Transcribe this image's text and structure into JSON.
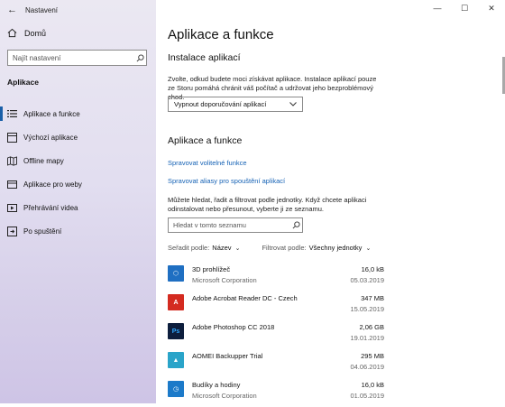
{
  "window": {
    "title": "Nastavení",
    "controls": [
      "—",
      "☐",
      "✕"
    ]
  },
  "sidebar": {
    "home_label": "Domů",
    "search_placeholder": "Najít nastavení",
    "section_label": "Aplikace",
    "items": [
      {
        "label": "Aplikace a funkce",
        "icon": "list-icon",
        "active": true
      },
      {
        "label": "Výchozí aplikace",
        "icon": "default-apps-icon",
        "active": false
      },
      {
        "label": "Offline mapy",
        "icon": "map-icon",
        "active": false
      },
      {
        "label": "Aplikace pro weby",
        "icon": "web-apps-icon",
        "active": false
      },
      {
        "label": "Přehrávání videa",
        "icon": "video-icon",
        "active": false
      },
      {
        "label": "Po spuštění",
        "icon": "startup-icon",
        "active": false
      }
    ]
  },
  "main": {
    "title": "Aplikace a funkce",
    "install_heading": "Instalace aplikací",
    "install_desc": "Zvolte, odkud budete moci získávat aplikace. Instalace aplikací pouze ze Storu pomáhá chránit váš počítač a udržovat jeho bezproblémový chod.",
    "install_dropdown": "Vypnout doporučování aplikací",
    "apps_heading": "Aplikace a funkce",
    "link_optional": "Spravovat volitelné funkce",
    "link_aliases": "Spravovat aliasy pro spouštění aplikací",
    "apps_desc": "Můžete hledat, řadit a filtrovat podle jednotky. Když chcete aplikaci odinstalovat nebo přesunout, vyberte ji ze seznamu.",
    "apps_search_placeholder": "Hledat v tomto seznamu",
    "sort_label": "Seřadit podle:",
    "sort_value": "Název",
    "filter_label": "Filtrovat podle:",
    "filter_value": "Všechny jednotky"
  },
  "apps": [
    {
      "name": "3D prohlížeč",
      "publisher": "Microsoft Corporation",
      "size": "16,0 kB",
      "date": "05.03.2019",
      "icon_bg": "#1f6fc2",
      "icon_glyph": "⬡"
    },
    {
      "name": "Adobe Acrobat Reader DC - Czech",
      "publisher": "",
      "size": "347 MB",
      "date": "15.05.2019",
      "icon_bg": "#d42b20",
      "icon_glyph": "A"
    },
    {
      "name": "Adobe Photoshop CC 2018",
      "publisher": "",
      "size": "2,06 GB",
      "date": "19.01.2019",
      "icon_bg": "#0d1e3d",
      "icon_glyph": "Ps"
    },
    {
      "name": "AOMEI Backupper Trial",
      "publisher": "",
      "size": "295 MB",
      "date": "04.06.2019",
      "icon_bg": "#2aa4c9",
      "icon_glyph": "▲"
    },
    {
      "name": "Budíky a hodiny",
      "publisher": "Microsoft Corporation",
      "size": "16,0 kB",
      "date": "01.05.2019",
      "icon_bg": "#1c7ac9",
      "icon_glyph": "◷"
    }
  ]
}
